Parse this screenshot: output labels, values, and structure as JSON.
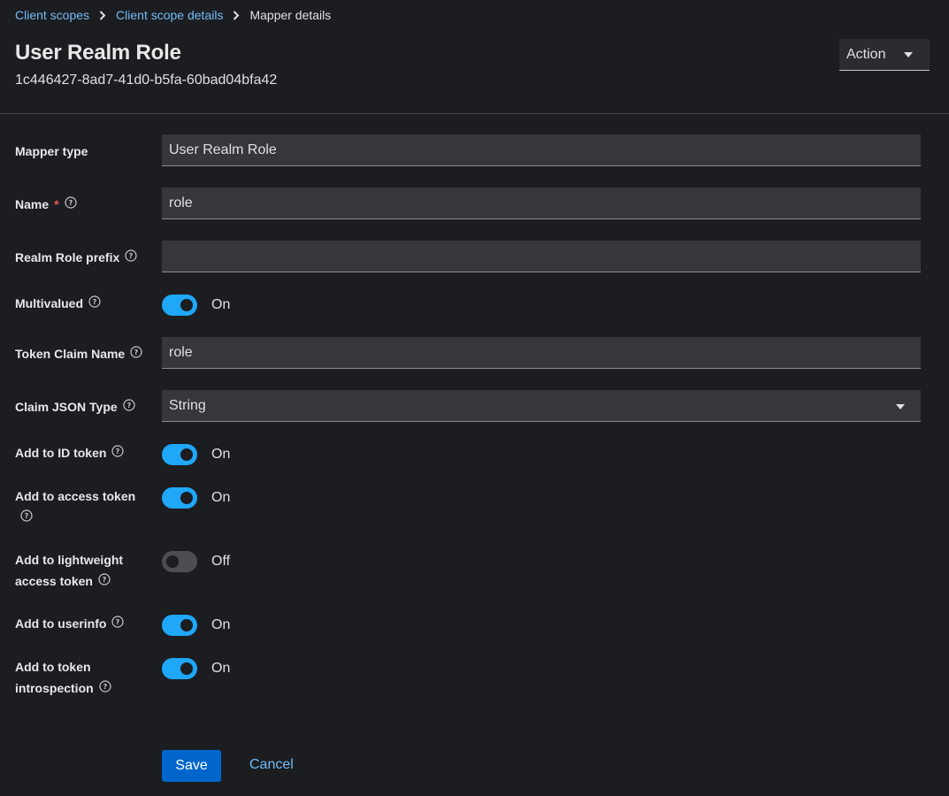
{
  "breadcrumb": {
    "items": [
      "Client scopes",
      "Client scope details"
    ],
    "current": "Mapper details"
  },
  "header": {
    "title": "User Realm Role",
    "id": "1c446427-8ad7-41d0-b5fa-60bad04bfa42",
    "action_label": "Action"
  },
  "form": {
    "mapper_type": {
      "label": "Mapper type",
      "value": "User Realm Role"
    },
    "name": {
      "label": "Name",
      "required_mark": "*",
      "value": "role"
    },
    "realm_role_prefix": {
      "label": "Realm Role prefix",
      "value": ""
    },
    "multivalued": {
      "label": "Multivalued",
      "state": "On"
    },
    "token_claim_name": {
      "label": "Token Claim Name",
      "value": "role"
    },
    "claim_json_type": {
      "label": "Claim JSON Type",
      "value": "String"
    },
    "add_to_id_token": {
      "label": "Add to ID token",
      "state": "On"
    },
    "add_to_access_token": {
      "label": "Add to access token",
      "state": "On"
    },
    "add_to_lightweight": {
      "label_line1": "Add to lightweight",
      "label_line2": "access token",
      "state": "Off"
    },
    "add_to_userinfo": {
      "label": "Add to userinfo",
      "state": "On"
    },
    "add_to_introspection": {
      "label_line1": "Add to token",
      "label_line2": "introspection",
      "state": "On"
    }
  },
  "actions": {
    "save_label": "Save",
    "cancel_label": "Cancel"
  },
  "colors": {
    "accent": "#1fa7f8",
    "link": "#73bcf7",
    "primary_button": "#0066cc",
    "background": "#1b1d21"
  }
}
